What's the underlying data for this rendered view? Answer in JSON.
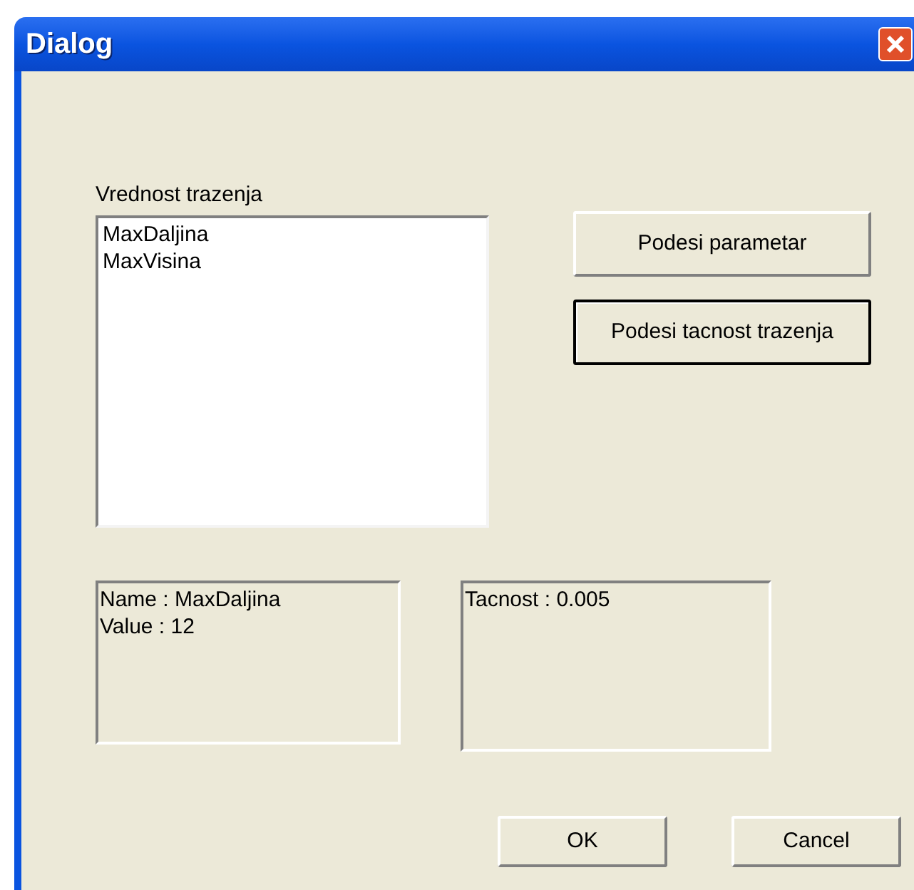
{
  "window": {
    "title": "Dialog"
  },
  "list_label": "Vrednost trazenja",
  "list": {
    "items": [
      "MaxDaljina",
      "MaxVisina"
    ]
  },
  "side_buttons": [
    {
      "label": "Podesi parametar",
      "default": false
    },
    {
      "label": "Podesi tacnost trazenja",
      "default": true
    }
  ],
  "info_panels": [
    {
      "lines": [
        "Name : MaxDaljina",
        "Value : 12"
      ]
    },
    {
      "lines": [
        "Tacnost : 0.005"
      ]
    }
  ],
  "footer_buttons": [
    "OK",
    "Cancel"
  ]
}
